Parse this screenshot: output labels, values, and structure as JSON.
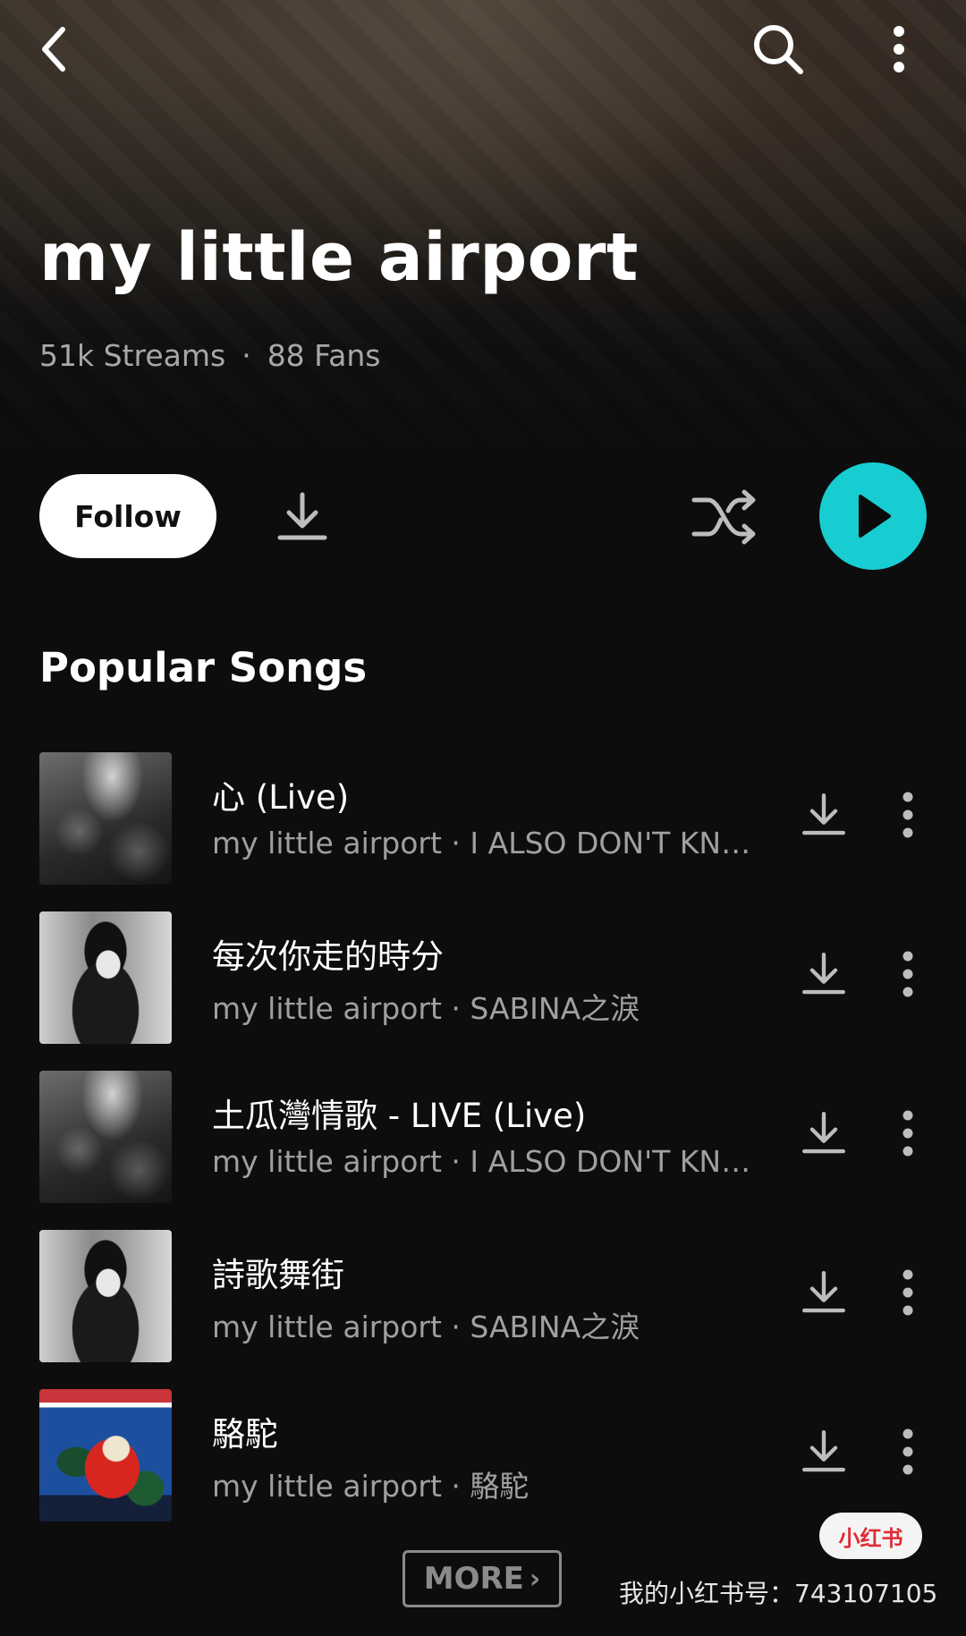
{
  "artist": {
    "name": "my little airport",
    "streams": "51k Streams",
    "separator": "·",
    "fans": "88 Fans"
  },
  "actions": {
    "follow_label": "Follow"
  },
  "colors": {
    "accent": "#17cdd2",
    "background": "#0d0d0d"
  },
  "icons": {
    "back": "chevron-left-icon",
    "search": "search-icon",
    "more": "more-vertical-icon",
    "download": "download-icon",
    "shuffle": "shuffle-icon",
    "play": "play-icon"
  },
  "section": {
    "title": "Popular Songs"
  },
  "songs": [
    {
      "title": "心 (Live)",
      "subtitle": "my little airport · I ALSO DON'T KNOW WHAT TO DO"
    },
    {
      "title": "每次你走的時分",
      "subtitle": "my little airport · SABINA之淚"
    },
    {
      "title": "土瓜灣情歌 - LIVE (Live)",
      "subtitle": "my little airport · I ALSO DON'T KNOW WHAT TO DO"
    },
    {
      "title": "詩歌舞街",
      "subtitle": "my little airport · SABINA之淚"
    },
    {
      "title": "駱駝",
      "subtitle": "my little airport · 駱駝"
    }
  ],
  "footer": {
    "more_label": "MORE",
    "badge": "小红书",
    "watermark": "我的小红书号：743107105"
  }
}
